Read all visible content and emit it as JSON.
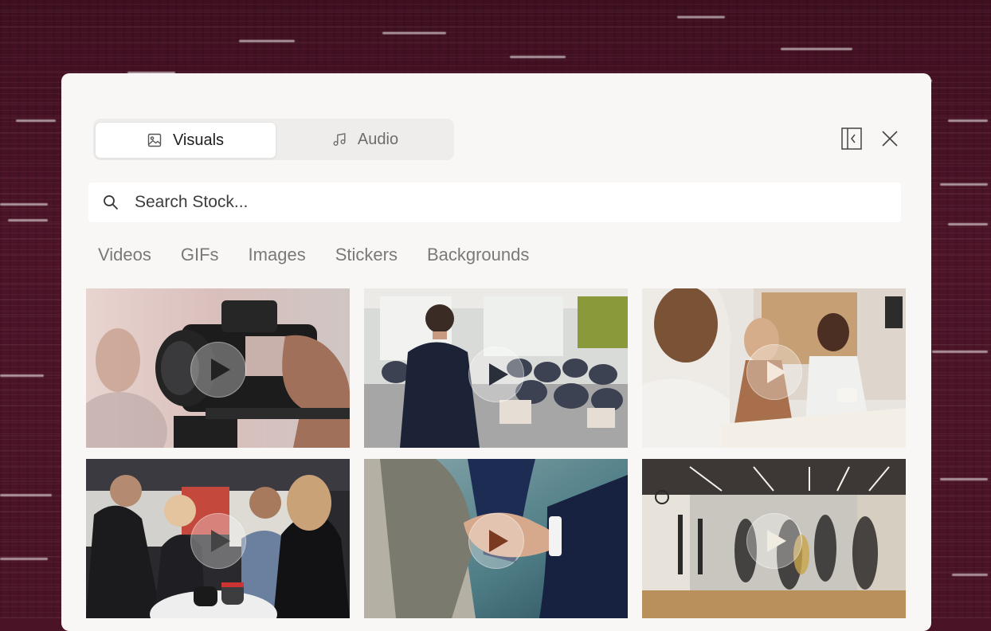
{
  "tabs": {
    "visuals_label": "Visuals",
    "audio_label": "Audio"
  },
  "search": {
    "placeholder": "Search Stock..."
  },
  "filters": [
    "Videos",
    "GIFs",
    "Images",
    "Stickers",
    "Backgrounds"
  ],
  "results": [
    {
      "subject": "Camera filming portrait",
      "media": "video"
    },
    {
      "subject": "Speaker at conference audience",
      "media": "video"
    },
    {
      "subject": "Interview with two women at desk",
      "media": "video"
    },
    {
      "subject": "Group talking at trade show",
      "media": "video"
    },
    {
      "subject": "Business handshake",
      "media": "video"
    },
    {
      "subject": "People walking in office",
      "media": "video"
    }
  ],
  "colors": {
    "backdrop": "#4a1326",
    "panel": "#f8f7f6",
    "active_tab": "#ffffff",
    "muted_text": "#7b7977"
  }
}
